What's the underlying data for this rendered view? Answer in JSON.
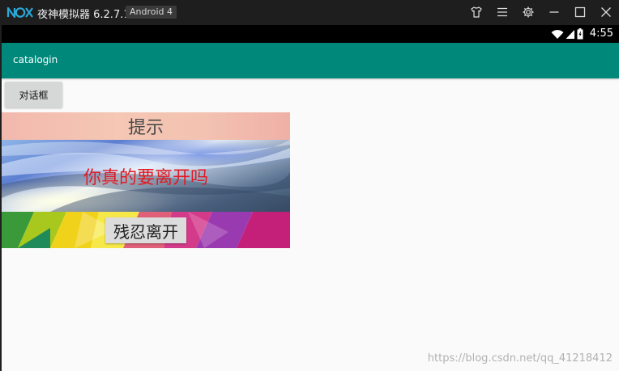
{
  "emulator": {
    "title": "夜神模拟器 6.2.7.1",
    "badge": "Android 4"
  },
  "status_bar": {
    "time": "4:55"
  },
  "app_bar": {
    "title": "catalogin"
  },
  "main": {
    "dialog_button_label": "对话框"
  },
  "dialog": {
    "title": "提示",
    "message": "你真的要离开吗",
    "button_label": "残忍离开"
  },
  "watermark": "https://blog.csdn.net/qq_41218412",
  "colors": {
    "app_bar": "#00897b",
    "message_text": "#e11b24",
    "logo": "#2aa8d8"
  }
}
